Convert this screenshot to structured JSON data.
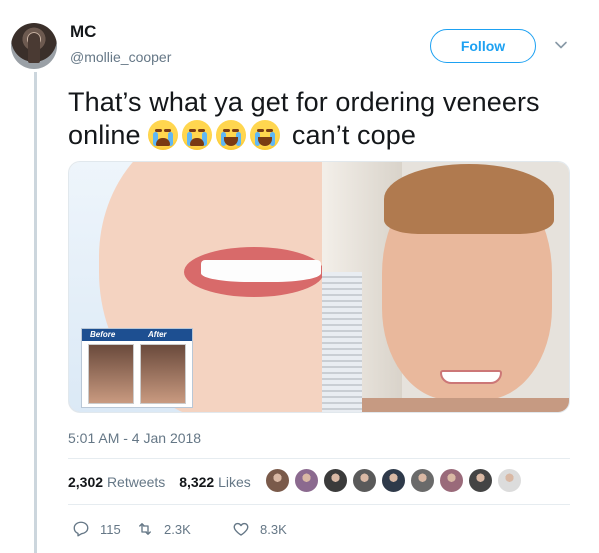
{
  "user": {
    "name": "MC",
    "handle": "@mollie_cooper"
  },
  "follow_label": "Follow",
  "tweet": {
    "text_part1": "That’s what ya get for ordering veneers online",
    "emojis": [
      "loudly-crying-face",
      "loudly-crying-face",
      "face-with-tears-of-joy",
      "face-with-tears-of-joy"
    ],
    "text_part2": "can’t cope"
  },
  "media": {
    "before_label": "Before",
    "after_label": "After"
  },
  "timestamp": "5:01 AM - 4 Jan 2018",
  "stats": {
    "retweets_count": "2,302",
    "retweets_label": "Retweets",
    "likes_count": "8,322",
    "likes_label": "Likes"
  },
  "likers_count": 9,
  "actions": {
    "reply_count": "115",
    "retweet_count": "2.3K",
    "like_count": "8.3K"
  },
  "colors": {
    "accent": "#1da1f2",
    "text": "#14171a",
    "secondary": "#657786",
    "divider": "#e6ecf0"
  }
}
